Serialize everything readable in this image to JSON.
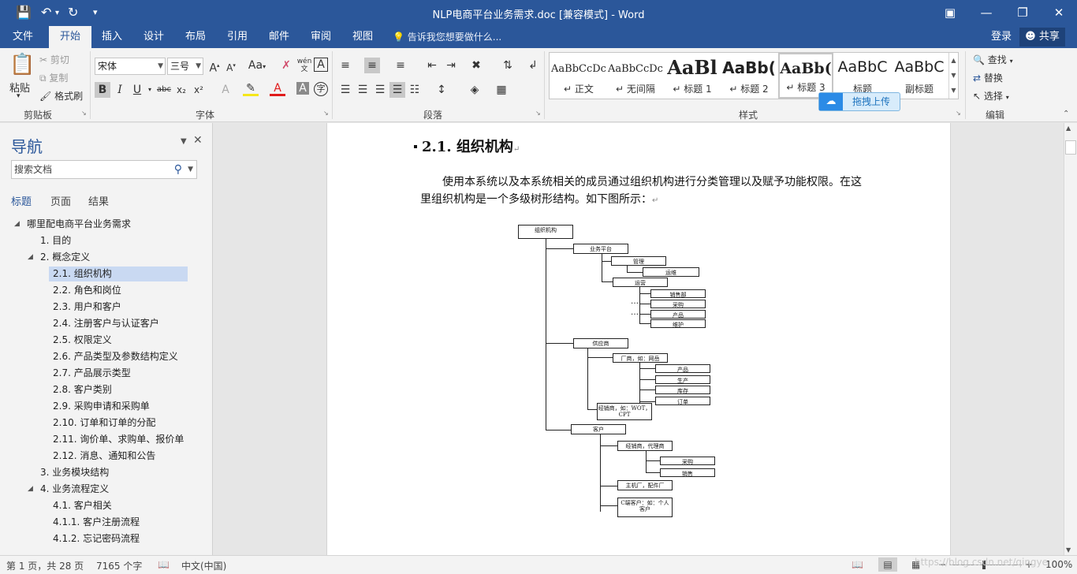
{
  "titlebar": {
    "title": "NLP电商平台业务需求.doc [兼容模式] - Word",
    "save_icon": "save-icon",
    "undo_icon": "undo-icon",
    "redo_icon": "redo-icon"
  },
  "tabs": [
    "文件",
    "开始",
    "插入",
    "设计",
    "布局",
    "引用",
    "邮件",
    "审阅",
    "视图"
  ],
  "tell_me": "告诉我您想要做什么...",
  "login": "登录",
  "share": "共享",
  "ribbon": {
    "clipboard": {
      "paste": "粘贴",
      "cut": "剪切",
      "copy": "复制",
      "format_painter": "格式刷",
      "label": "剪贴板"
    },
    "font": {
      "name": "宋体",
      "size": "三号",
      "label": "字体",
      "case": "Aa",
      "bold": "B",
      "italic": "I",
      "underline": "U",
      "strike": "abc",
      "sub": "x₂",
      "sup": "x²"
    },
    "paragraph": {
      "label": "段落"
    },
    "styles": {
      "label": "样式",
      "items": [
        {
          "preview": "AaBbCcDc",
          "name": "正文"
        },
        {
          "preview": "AaBbCcDc",
          "name": "无间隔"
        },
        {
          "preview": "AaBl",
          "name": "标题 1"
        },
        {
          "preview": "AaBb(",
          "name": "标题 2"
        },
        {
          "preview": "AaBb(",
          "name": "标题 3"
        },
        {
          "preview": "AaBbC",
          "name": "标题"
        },
        {
          "preview": "AaBbC",
          "name": "副标题"
        }
      ]
    },
    "editing": {
      "find": "查找",
      "replace": "替换",
      "select": "选择",
      "label": "编辑"
    },
    "upload_button": "拖拽上传"
  },
  "nav": {
    "title": "导航",
    "search_placeholder": "搜索文档",
    "tabs": [
      "标题",
      "页面",
      "结果"
    ],
    "items": [
      {
        "label": "哪里配电商平台业务需求",
        "toggle": "◢"
      },
      {
        "label": "1. 目的",
        "toggle": ""
      },
      {
        "label": "2. 概念定义",
        "toggle": "◢"
      },
      {
        "label": "2.1. 组织机构",
        "toggle": ""
      },
      {
        "label": "2.2. 角色和岗位",
        "toggle": ""
      },
      {
        "label": "2.3. 用户和客户",
        "toggle": ""
      },
      {
        "label": "2.4. 注册客户与认证客户",
        "toggle": ""
      },
      {
        "label": "2.5. 权限定义",
        "toggle": ""
      },
      {
        "label": "2.6. 产品类型及参数结构定义",
        "toggle": ""
      },
      {
        "label": "2.7. 产品展示类型",
        "toggle": ""
      },
      {
        "label": "2.8. 客户类别",
        "toggle": ""
      },
      {
        "label": "2.9. 采购申请和采购单",
        "toggle": ""
      },
      {
        "label": "2.10. 订单和订单的分配",
        "toggle": ""
      },
      {
        "label": "2.11. 询价单、求购单、报价单",
        "toggle": ""
      },
      {
        "label": "2.12. 消息、通知和公告",
        "toggle": ""
      },
      {
        "label": "3. 业务模块结构",
        "toggle": ""
      },
      {
        "label": "4. 业务流程定义",
        "toggle": "◢"
      },
      {
        "label": "4.1. 客户相关",
        "toggle": ""
      },
      {
        "label": "4.1.1. 客户注册流程",
        "toggle": ""
      },
      {
        "label": "4.1.2. 忘记密码流程",
        "toggle": ""
      }
    ]
  },
  "document": {
    "heading": "2.1. 组织机构",
    "para_line1": "使用本系统以及本系统相关的成员通过组织机构进行分类管理以及赋予功能权限。在这",
    "para_line2": "里组织机构是一个多级树形结构。如下图所示：",
    "orgchart": {
      "root": "组织机构",
      "platform": "业务平台",
      "manage": "管理",
      "ops_sub": "运维",
      "operate": "运营",
      "sales_dept": "销售部",
      "purchase": "采购",
      "product": "产品",
      "maintain": "维护",
      "supplier": "供应商",
      "manufacturer": "厂商，如：网岳",
      "m_product": "产品",
      "m_produce": "生产",
      "m_stock": "库存",
      "m_order": "订单",
      "dealer": "经销商，如：WOT，CPT",
      "customer": "客户",
      "c_dealer": "经销商，代理商",
      "c_purchase": "采购",
      "c_sales": "销售",
      "c_oem": "主机厂，配件厂",
      "c_end": "C端客户：如：个人客户"
    }
  },
  "status": {
    "page": "第 1 页，共 28 页",
    "words": "7165 个字",
    "lang": "中文(中国)",
    "zoom": "100%"
  },
  "watermark": "https://blog.csdn.net/qingye"
}
